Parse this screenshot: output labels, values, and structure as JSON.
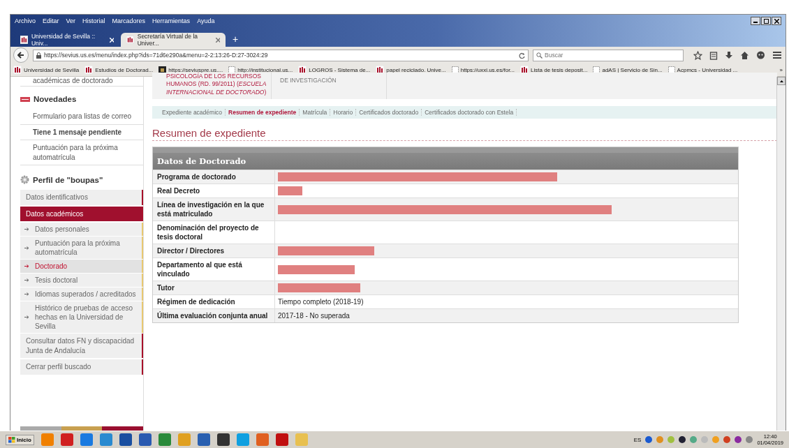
{
  "window": {
    "menu": [
      "Archivo",
      "Editar",
      "Ver",
      "Historial",
      "Marcadores",
      "Herramientas",
      "Ayuda"
    ]
  },
  "tabs": [
    {
      "label": "Universidad de Sevilla :: Univ...",
      "selected": false
    },
    {
      "label": "Secretaría Virtual de la Univer...",
      "selected": true
    }
  ],
  "new_tab": "+",
  "address": {
    "value": "https://sevius.us.es/menu/index.php?ids=71d6e290a&menu=2-2:13:26-D:27-3024:29"
  },
  "search": {
    "placeholder": "Buscar"
  },
  "bookmarks": [
    {
      "label": "Universidad de Sevilla",
      "kind": "us"
    },
    {
      "label": "Estudios de Doctorad...",
      "kind": "us"
    },
    {
      "label": "https://seviuspre.us....",
      "kind": "dark"
    },
    {
      "label": "http://institucional.us...",
      "kind": "blank"
    },
    {
      "label": "LOGROS - Sistema de...",
      "kind": "us"
    },
    {
      "label": "papel reciclado. Unive...",
      "kind": "us"
    },
    {
      "label": "https://uxxi.us.es/for...",
      "kind": "blank"
    },
    {
      "label": "Lista de tesis deposit...",
      "kind": "us"
    },
    {
      "label": "adAS | Servicio de Sin...",
      "kind": "blank"
    },
    {
      "label": "Acpmcs - Universidad ...",
      "kind": "blank"
    }
  ],
  "bookmarks_more": "»",
  "sidebar": {
    "cut_item": "académicas de doctorado",
    "news_title": "Novedades",
    "news": [
      {
        "label": "Formulario para listas de correo",
        "bold": false
      },
      {
        "label": "Tiene 1 mensaje pendiente",
        "bold": true
      },
      {
        "label": "Puntuación para la próxima automatrícula",
        "bold": false
      }
    ],
    "profile_title": "Perfil de \"boupas\"",
    "menu": [
      {
        "label": "Datos identificativos",
        "selected": false
      },
      {
        "label": "Datos académicos",
        "selected": true,
        "children": [
          {
            "label": "Datos personales",
            "selected": false
          },
          {
            "label": "Puntuación para la próxima automatrícula",
            "selected": false
          },
          {
            "label": "Doctorado",
            "selected": true
          },
          {
            "label": "Tesis doctoral",
            "selected": false
          },
          {
            "label": "Idiomas superados / acreditados",
            "selected": false
          },
          {
            "label": "Histórico de pruebas de acceso hechas en la Universidad de Sevilla",
            "selected": false
          }
        ]
      },
      {
        "label": "Consultar datos FN y discapacidad Junta de Andalucía",
        "selected": false
      },
      {
        "label": "Cerrar perfil buscado",
        "selected": false
      }
    ]
  },
  "header": {
    "program": "PSICOLOGÍA DE LOS RECURSOS HUMANOS (RD. 99/2011) (*ESCUELA INTERNACIONAL DE DOCTORADO*)",
    "column_2": "DE INVESTIGACIÓN"
  },
  "subtabs": [
    {
      "label": "Expediente académico",
      "selected": false
    },
    {
      "label": "Resumen de expediente",
      "selected": true
    },
    {
      "label": "Matrícula",
      "selected": false
    },
    {
      "label": "Horario",
      "selected": false
    },
    {
      "label": "Certificados doctorado",
      "selected": false
    },
    {
      "label": "Certificados doctorado con Estela",
      "selected": false
    }
  ],
  "page_title": "Resumen de expediente",
  "table": {
    "title": "Datos de Doctorado",
    "rows": [
      {
        "label": "Programa de doctorado",
        "kind": "redacted"
      },
      {
        "label": "Real Decreto",
        "kind": "redacted"
      },
      {
        "label": "Línea de investigación en la que está matriculado",
        "kind": "redacted"
      },
      {
        "label": "Denominación del proyecto de tesis doctoral",
        "kind": "empty"
      },
      {
        "label": "Director / Directores",
        "kind": "redacted"
      },
      {
        "label": "Departamento al que está vinculado",
        "kind": "redacted"
      },
      {
        "label": "Tutor",
        "kind": "redacted"
      },
      {
        "label": "Régimen de dedicación",
        "kind": "text",
        "value": "Tiempo completo (2018-19)"
      },
      {
        "label": "Última evaluación conjunta anual",
        "kind": "text",
        "value": "2017-18 - No superada"
      }
    ]
  },
  "taskbar": {
    "start": "Inicio",
    "language": "ES",
    "time": "12:40",
    "date": "01/04/2019"
  }
}
